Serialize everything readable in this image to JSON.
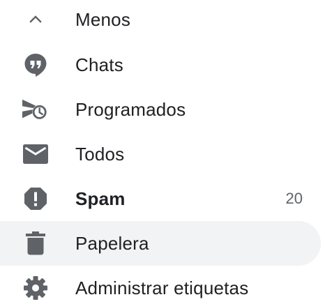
{
  "nav": {
    "items": [
      {
        "label": "Menos",
        "icon": "chevron-up-icon"
      },
      {
        "label": "Chats",
        "icon": "chat-bubble-icon"
      },
      {
        "label": "Programados",
        "icon": "scheduled-send-icon"
      },
      {
        "label": "Todos",
        "icon": "envelope-icon"
      },
      {
        "label": "Spam",
        "icon": "spam-report-icon",
        "count": "20",
        "bold": true
      },
      {
        "label": "Papelera",
        "icon": "trash-icon",
        "selected": true
      },
      {
        "label": "Administrar etiquetas",
        "icon": "gear-icon"
      }
    ]
  },
  "colors": {
    "icon": "#5f6368",
    "text": "#202124",
    "selected_bg": "#f1f3f4"
  }
}
